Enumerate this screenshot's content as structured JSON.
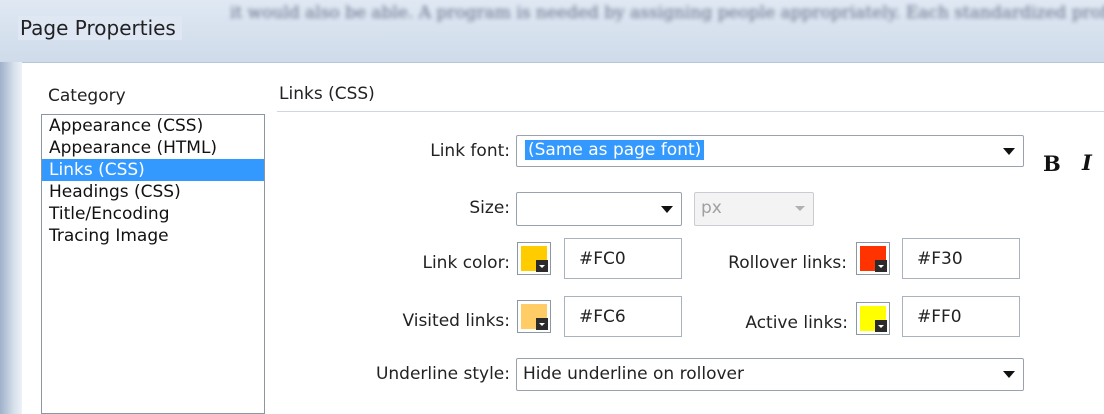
{
  "window": {
    "title": "Page Properties"
  },
  "background_text": "it would also be able. A program is needed by assigning people appropriately. Each standardized professional value systems of comparative perspectives of the",
  "category": {
    "label": "Category",
    "items": [
      {
        "label": "Appearance (CSS)",
        "selected": false
      },
      {
        "label": "Appearance (HTML)",
        "selected": false
      },
      {
        "label": "Links (CSS)",
        "selected": true
      },
      {
        "label": "Headings (CSS)",
        "selected": false
      },
      {
        "label": "Title/Encoding",
        "selected": false
      },
      {
        "label": "Tracing Image",
        "selected": false
      }
    ]
  },
  "section": {
    "title": "Links (CSS)",
    "link_font": {
      "label": "Link font:",
      "value": "(Same as page font)"
    },
    "bold_label": "B",
    "italic_label": "I",
    "size": {
      "label": "Size:",
      "value": "",
      "unit": "px"
    },
    "link_color": {
      "label": "Link color:",
      "hex": "#FC0",
      "swatch": "#ffcc00"
    },
    "rollover_links": {
      "label": "Rollover links:",
      "hex": "#F30",
      "swatch": "#ff3300"
    },
    "visited_links": {
      "label": "Visited links:",
      "hex": "#FC6",
      "swatch": "#ffcc66"
    },
    "active_links": {
      "label": "Active links:",
      "hex": "#FF0",
      "swatch": "#ffff00"
    },
    "underline_style": {
      "label": "Underline style:",
      "value": "Hide underline on rollover"
    }
  }
}
